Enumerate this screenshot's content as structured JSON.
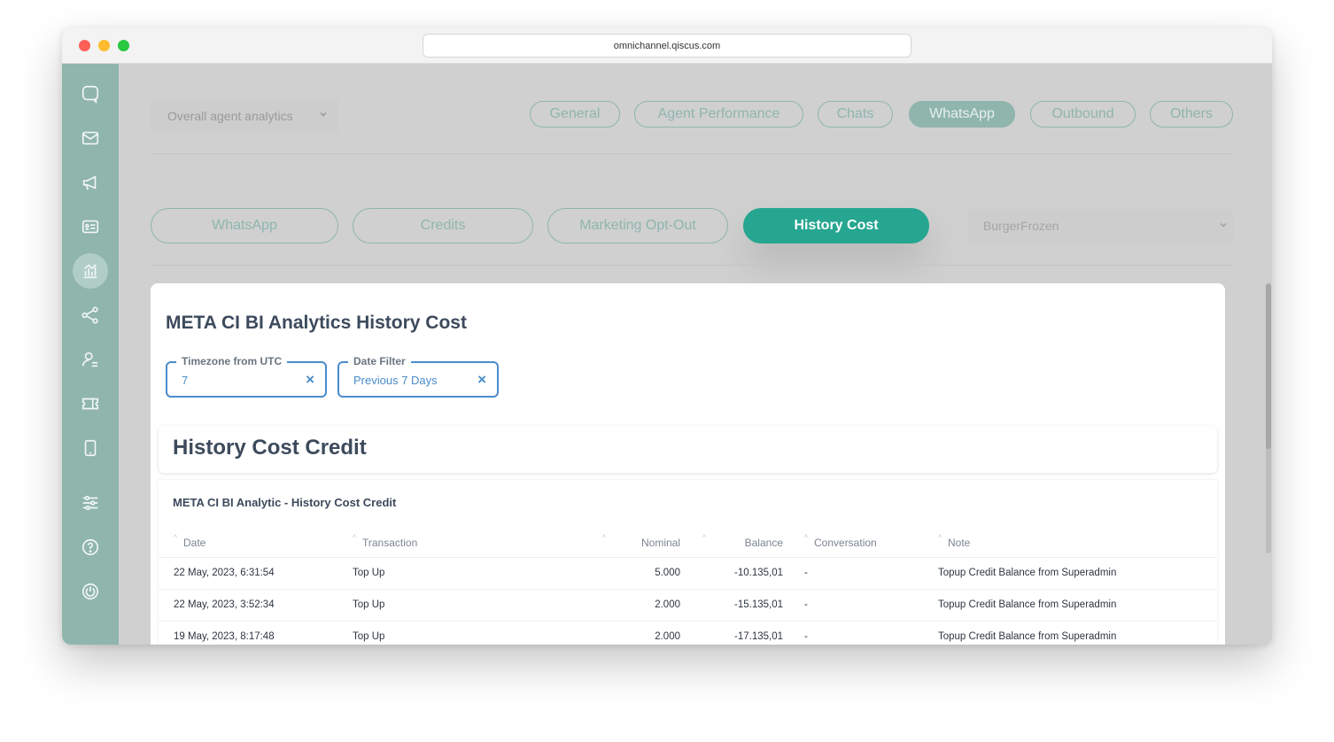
{
  "browser": {
    "url": "omnichannel.qiscus.com"
  },
  "sidebar": {
    "items": [
      {
        "icon": "chat-bubble-icon"
      },
      {
        "icon": "mail-icon"
      },
      {
        "icon": "megaphone-icon"
      },
      {
        "icon": "contact-card-icon"
      },
      {
        "icon": "analytics-icon",
        "active": true
      },
      {
        "icon": "share-nodes-icon"
      },
      {
        "icon": "agent-user-icon"
      },
      {
        "icon": "ticket-icon"
      },
      {
        "icon": "mobile-device-icon"
      },
      {
        "icon": "settings-sliders-icon"
      },
      {
        "icon": "help-icon"
      },
      {
        "icon": "power-icon"
      }
    ],
    "accent": "#8fb5ad"
  },
  "header": {
    "agent_select": "Overall agent analytics",
    "tabs": [
      "General",
      "Agent Performance",
      "Chats",
      "WhatsApp",
      "Outbound",
      "Others"
    ],
    "active_tab": "WhatsApp"
  },
  "subtabs": {
    "items": [
      "WhatsApp",
      "Credits",
      "Marketing Opt-Out",
      "History Cost"
    ],
    "active": "History Cost",
    "active_color": "#26a690",
    "workspace_select": "BurgerFrozen"
  },
  "panel": {
    "title": "META CI BI Analytics History Cost",
    "filters": {
      "timezone": {
        "label": "Timezone from UTC",
        "value": "7"
      },
      "date": {
        "label": "Date Filter",
        "value": "Previous 7 Days"
      }
    },
    "close_glyph": "×",
    "section_title": "History Cost Credit",
    "table": {
      "title": "META CI BI Analytic - History Cost Credit",
      "sort_glyph": "^",
      "columns": [
        "Date",
        "Transaction",
        "Nominal",
        "Balance",
        "Conversation",
        "Note"
      ],
      "rows": [
        [
          "22 May, 2023, 6:31:54",
          "Top Up",
          "5.000",
          "-10.135,01",
          "-",
          "Topup Credit Balance from Superadmin"
        ],
        [
          "22 May, 2023, 3:52:34",
          "Top Up",
          "2.000",
          "-15.135,01",
          "-",
          "Topup Credit Balance from Superadmin"
        ],
        [
          "19 May, 2023, 8:17:48",
          "Top Up",
          "2.000",
          "-17.135,01",
          "-",
          "Topup Credit Balance from Superadmin"
        ]
      ]
    }
  }
}
